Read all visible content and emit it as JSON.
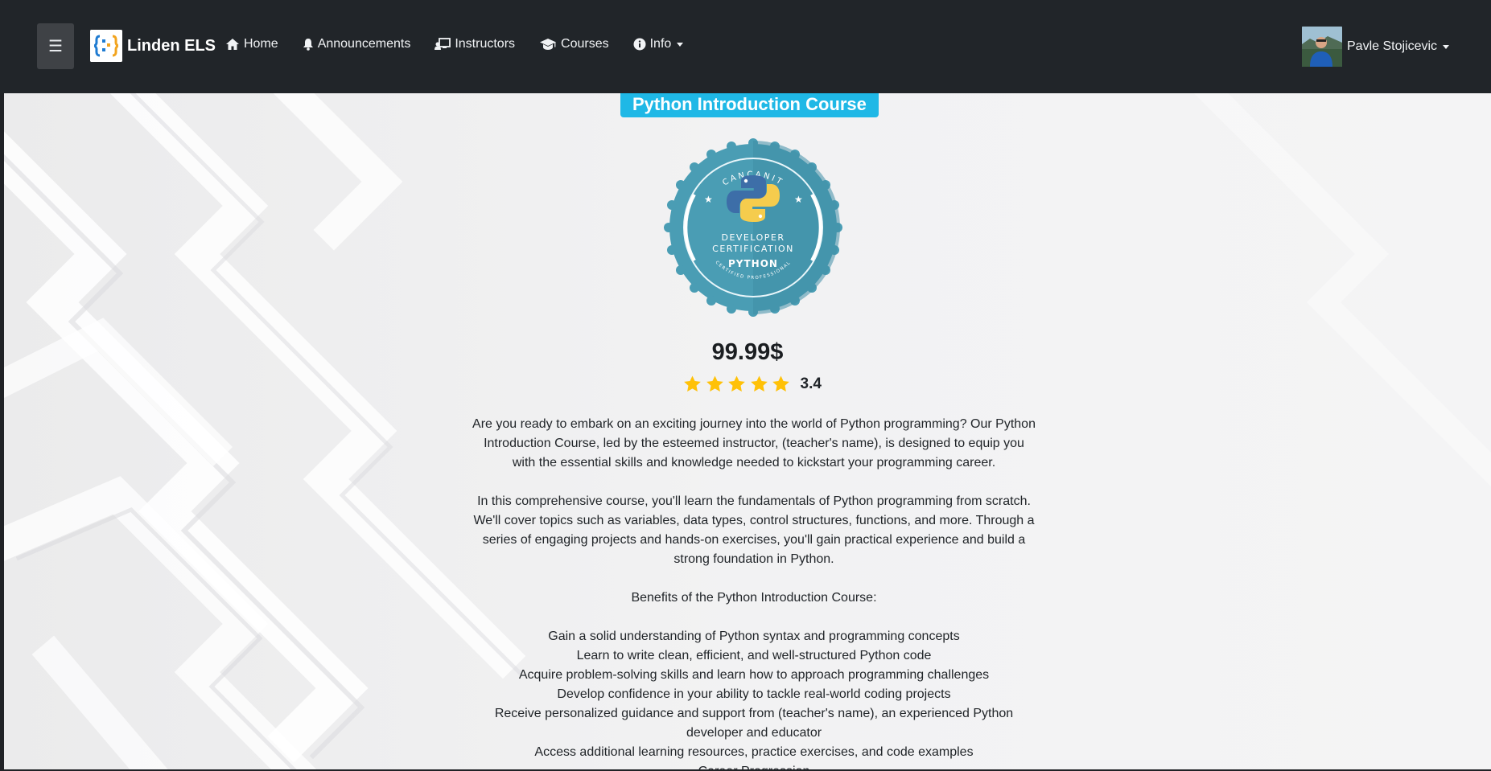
{
  "navbar": {
    "menu_glyph": "☰",
    "brand": "Linden ELS",
    "links": [
      {
        "label": "Home",
        "icon": "home-icon"
      },
      {
        "label": "Announcements",
        "icon": "bell-icon"
      },
      {
        "label": "Instructors",
        "icon": "chalkboard-teacher-icon"
      },
      {
        "label": "Courses",
        "icon": "graduation-cap-icon"
      },
      {
        "label": "Info",
        "icon": "info-circle-icon"
      }
    ],
    "user": {
      "name": "Pavle Stojicevic"
    }
  },
  "course": {
    "title": "Python Introduction Course",
    "badge": {
      "top_text": "CANCANIT",
      "line1": "DEVELOPER",
      "line2": "CERTIFICATION",
      "line3": "PYTHON",
      "bottom_text": "CERTIFIED PROFESSIONAL"
    },
    "price": "99.99$",
    "rating": {
      "value": "3.4",
      "stars": 5
    },
    "description": {
      "intro": "Are you ready to embark on an exciting journey into the world of Python programming? Our Python Introduction Course, led by the esteemed instructor, (teacher's name), is designed to equip you with the essential skills and knowledge needed to kickstart your programming career.",
      "para2": "In this comprehensive course, you'll learn the fundamentals of Python programming from scratch. We'll cover topics such as variables, data types, control structures, functions, and more. Through a series of engaging projects and hands-on exercises, you'll gain practical experience and build a strong foundation in Python.",
      "benefits_heading": "Benefits of the Python Introduction Course:",
      "benefits": [
        "Gain a solid understanding of Python syntax and programming concepts",
        "Learn to write clean, efficient, and well-structured Python code",
        "Acquire problem-solving skills and learn how to approach programming challenges",
        "Develop confidence in your ability to tackle real-world coding projects",
        "Receive personalized guidance and support from (teacher's name), an experienced Python developer and educator",
        "Access additional learning resources, practice exercises, and code examples",
        "Career Progression"
      ]
    }
  },
  "colors": {
    "navbar_bg": "#212529",
    "title_accent": "#1fb8e6",
    "badge_teal": "#4a9db4",
    "star": "#ffc107"
  }
}
